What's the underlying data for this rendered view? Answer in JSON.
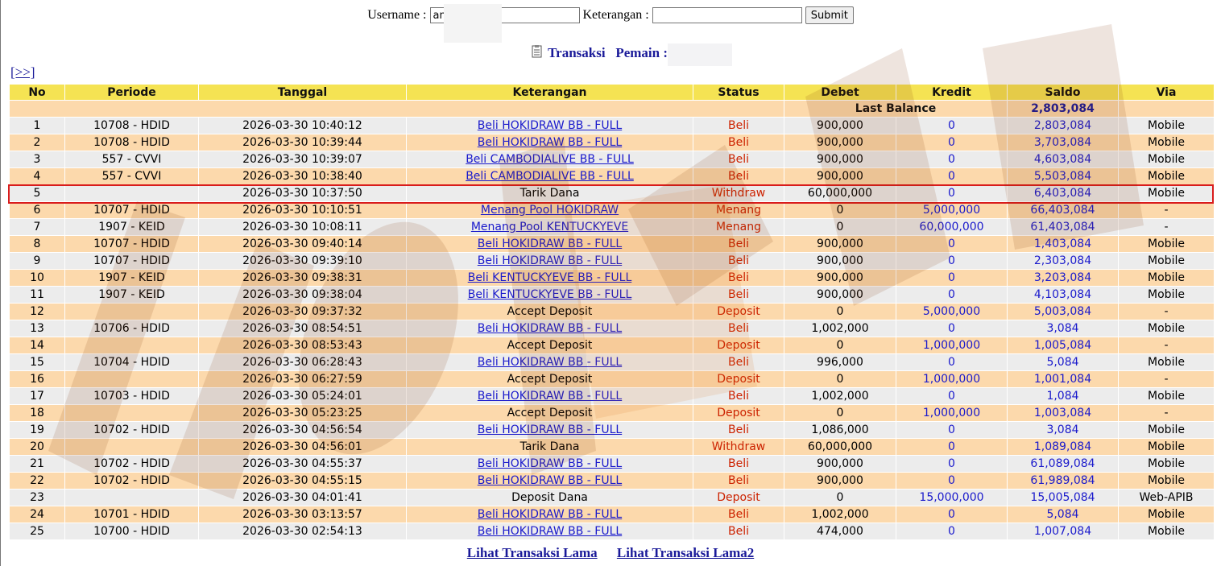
{
  "form": {
    "username_label": "Username :",
    "username_value": "am",
    "keterangan_label": "Keterangan :",
    "keterangan_value": "",
    "submit_label": "Submit"
  },
  "subtitle": {
    "transaksi": "Transaksi",
    "pemain": "Pemain : am"
  },
  "nav": {
    "more": "[>>]"
  },
  "table": {
    "headers": [
      "No",
      "Periode",
      "Tanggal",
      "Keterangan",
      "Status",
      "Debet",
      "Kredit",
      "Saldo",
      "Via"
    ],
    "last_balance_label": "Last Balance",
    "last_balance_value": "2,803,084",
    "rows": [
      {
        "no": "1",
        "periode": "10708 - HDID",
        "tanggal": "2026-03-30 10:40:12",
        "ket": "Beli HOKIDRAW BB - FULL",
        "link": true,
        "status": "Beli",
        "debet": "900,000",
        "kredit": "0",
        "saldo": "2,803,084",
        "via": "Mobile"
      },
      {
        "no": "2",
        "periode": "10708 - HDID",
        "tanggal": "2026-03-30 10:39:44",
        "ket": "Beli HOKIDRAW BB - FULL",
        "link": true,
        "status": "Beli",
        "debet": "900,000",
        "kredit": "0",
        "saldo": "3,703,084",
        "via": "Mobile"
      },
      {
        "no": "3",
        "periode": "557 - CVVI",
        "tanggal": "2026-03-30 10:39:07",
        "ket": "Beli CAMBODIALIVE BB - FULL",
        "link": true,
        "status": "Beli",
        "debet": "900,000",
        "kredit": "0",
        "saldo": "4,603,084",
        "via": "Mobile"
      },
      {
        "no": "4",
        "periode": "557 - CVVI",
        "tanggal": "2026-03-30 10:38:40",
        "ket": "Beli CAMBODIALIVE BB - FULL",
        "link": true,
        "status": "Beli",
        "debet": "900,000",
        "kredit": "0",
        "saldo": "5,503,084",
        "via": "Mobile"
      },
      {
        "no": "5",
        "periode": "",
        "tanggal": "2026-03-30 10:37:50",
        "ket": "Tarik Dana",
        "link": false,
        "status": "Withdraw",
        "debet": "60,000,000",
        "kredit": "0",
        "saldo": "6,403,084",
        "via": "Mobile"
      },
      {
        "no": "6",
        "periode": "10707 - HDID",
        "tanggal": "2026-03-30 10:10:51",
        "ket": "Menang Pool HOKIDRAW",
        "link": true,
        "status": "Menang",
        "debet": "0",
        "kredit": "5,000,000",
        "saldo": "66,403,084",
        "via": "-"
      },
      {
        "no": "7",
        "periode": "1907 - KEID",
        "tanggal": "2026-03-30 10:08:11",
        "ket": "Menang Pool KENTUCKYEVE",
        "link": true,
        "status": "Menang",
        "debet": "0",
        "kredit": "60,000,000",
        "saldo": "61,403,084",
        "via": "-"
      },
      {
        "no": "8",
        "periode": "10707 - HDID",
        "tanggal": "2026-03-30 09:40:14",
        "ket": "Beli HOKIDRAW BB - FULL",
        "link": true,
        "status": "Beli",
        "debet": "900,000",
        "kredit": "0",
        "saldo": "1,403,084",
        "via": "Mobile"
      },
      {
        "no": "9",
        "periode": "10707 - HDID",
        "tanggal": "2026-03-30 09:39:10",
        "ket": "Beli HOKIDRAW BB - FULL",
        "link": true,
        "status": "Beli",
        "debet": "900,000",
        "kredit": "0",
        "saldo": "2,303,084",
        "via": "Mobile"
      },
      {
        "no": "10",
        "periode": "1907 - KEID",
        "tanggal": "2026-03-30 09:38:31",
        "ket": "Beli KENTUCKYEVE BB - FULL",
        "link": true,
        "status": "Beli",
        "debet": "900,000",
        "kredit": "0",
        "saldo": "3,203,084",
        "via": "Mobile"
      },
      {
        "no": "11",
        "periode": "1907 - KEID",
        "tanggal": "2026-03-30 09:38:04",
        "ket": "Beli KENTUCKYEVE BB - FULL",
        "link": true,
        "status": "Beli",
        "debet": "900,000",
        "kredit": "0",
        "saldo": "4,103,084",
        "via": "Mobile"
      },
      {
        "no": "12",
        "periode": "",
        "tanggal": "2026-03-30 09:37:32",
        "ket": "Accept Deposit",
        "link": false,
        "status": "Deposit",
        "debet": "0",
        "kredit": "5,000,000",
        "saldo": "5,003,084",
        "via": "-"
      },
      {
        "no": "13",
        "periode": "10706 - HDID",
        "tanggal": "2026-03-30 08:54:51",
        "ket": "Beli HOKIDRAW BB - FULL",
        "link": true,
        "status": "Beli",
        "debet": "1,002,000",
        "kredit": "0",
        "saldo": "3,084",
        "via": "Mobile"
      },
      {
        "no": "14",
        "periode": "",
        "tanggal": "2026-03-30 08:53:43",
        "ket": "Accept Deposit",
        "link": false,
        "status": "Deposit",
        "debet": "0",
        "kredit": "1,000,000",
        "saldo": "1,005,084",
        "via": "-"
      },
      {
        "no": "15",
        "periode": "10704 - HDID",
        "tanggal": "2026-03-30 06:28:43",
        "ket": "Beli HOKIDRAW BB - FULL",
        "link": true,
        "status": "Beli",
        "debet": "996,000",
        "kredit": "0",
        "saldo": "5,084",
        "via": "Mobile"
      },
      {
        "no": "16",
        "periode": "",
        "tanggal": "2026-03-30 06:27:59",
        "ket": "Accept Deposit",
        "link": false,
        "status": "Deposit",
        "debet": "0",
        "kredit": "1,000,000",
        "saldo": "1,001,084",
        "via": "-"
      },
      {
        "no": "17",
        "periode": "10703 - HDID",
        "tanggal": "2026-03-30 05:24:01",
        "ket": "Beli HOKIDRAW BB - FULL",
        "link": true,
        "status": "Beli",
        "debet": "1,002,000",
        "kredit": "0",
        "saldo": "1,084",
        "via": "Mobile"
      },
      {
        "no": "18",
        "periode": "",
        "tanggal": "2026-03-30 05:23:25",
        "ket": "Accept Deposit",
        "link": false,
        "status": "Deposit",
        "debet": "0",
        "kredit": "1,000,000",
        "saldo": "1,003,084",
        "via": "-"
      },
      {
        "no": "19",
        "periode": "10702 - HDID",
        "tanggal": "2026-03-30 04:56:54",
        "ket": "Beli HOKIDRAW BB - FULL",
        "link": true,
        "status": "Beli",
        "debet": "1,086,000",
        "kredit": "0",
        "saldo": "3,084",
        "via": "Mobile"
      },
      {
        "no": "20",
        "periode": "",
        "tanggal": "2026-03-30 04:56:01",
        "ket": "Tarik Dana",
        "link": false,
        "status": "Withdraw",
        "debet": "60,000,000",
        "kredit": "0",
        "saldo": "1,089,084",
        "via": "Mobile"
      },
      {
        "no": "21",
        "periode": "10702 - HDID",
        "tanggal": "2026-03-30 04:55:37",
        "ket": "Beli HOKIDRAW BB - FULL",
        "link": true,
        "status": "Beli",
        "debet": "900,000",
        "kredit": "0",
        "saldo": "61,089,084",
        "via": "Mobile"
      },
      {
        "no": "22",
        "periode": "10702 - HDID",
        "tanggal": "2026-03-30 04:55:15",
        "ket": "Beli HOKIDRAW BB - FULL",
        "link": true,
        "status": "Beli",
        "debet": "900,000",
        "kredit": "0",
        "saldo": "61,989,084",
        "via": "Mobile"
      },
      {
        "no": "23",
        "periode": "",
        "tanggal": "2026-03-30 04:01:41",
        "ket": "Deposit Dana",
        "link": false,
        "status": "Deposit",
        "debet": "0",
        "kredit": "15,000,000",
        "saldo": "15,005,084",
        "via": "Web-APIB"
      },
      {
        "no": "24",
        "periode": "10701 - HDID",
        "tanggal": "2026-03-30 03:13:57",
        "ket": "Beli HOKIDRAW BB - FULL",
        "link": true,
        "status": "Beli",
        "debet": "1,002,000",
        "kredit": "0",
        "saldo": "5,084",
        "via": "Mobile"
      },
      {
        "no": "25",
        "periode": "10700 - HDID",
        "tanggal": "2026-03-30 02:54:13",
        "ket": "Beli HOKIDRAW BB - FULL",
        "link": true,
        "status": "Beli",
        "debet": "474,000",
        "kredit": "0",
        "saldo": "1,007,084",
        "via": "Mobile"
      }
    ]
  },
  "footer": {
    "link1": "Lihat Transaksi Lama",
    "link2": "Lihat Transaksi Lama2"
  },
  "colors": {
    "header_bg": "#f5e353",
    "row_odd": "#ececec",
    "row_even": "#fcd9ac",
    "status": "#cc2200",
    "link": "#1a1acc",
    "highlight": "#d91c1c"
  },
  "icons": {
    "subtitle_icon": "document-icon"
  }
}
